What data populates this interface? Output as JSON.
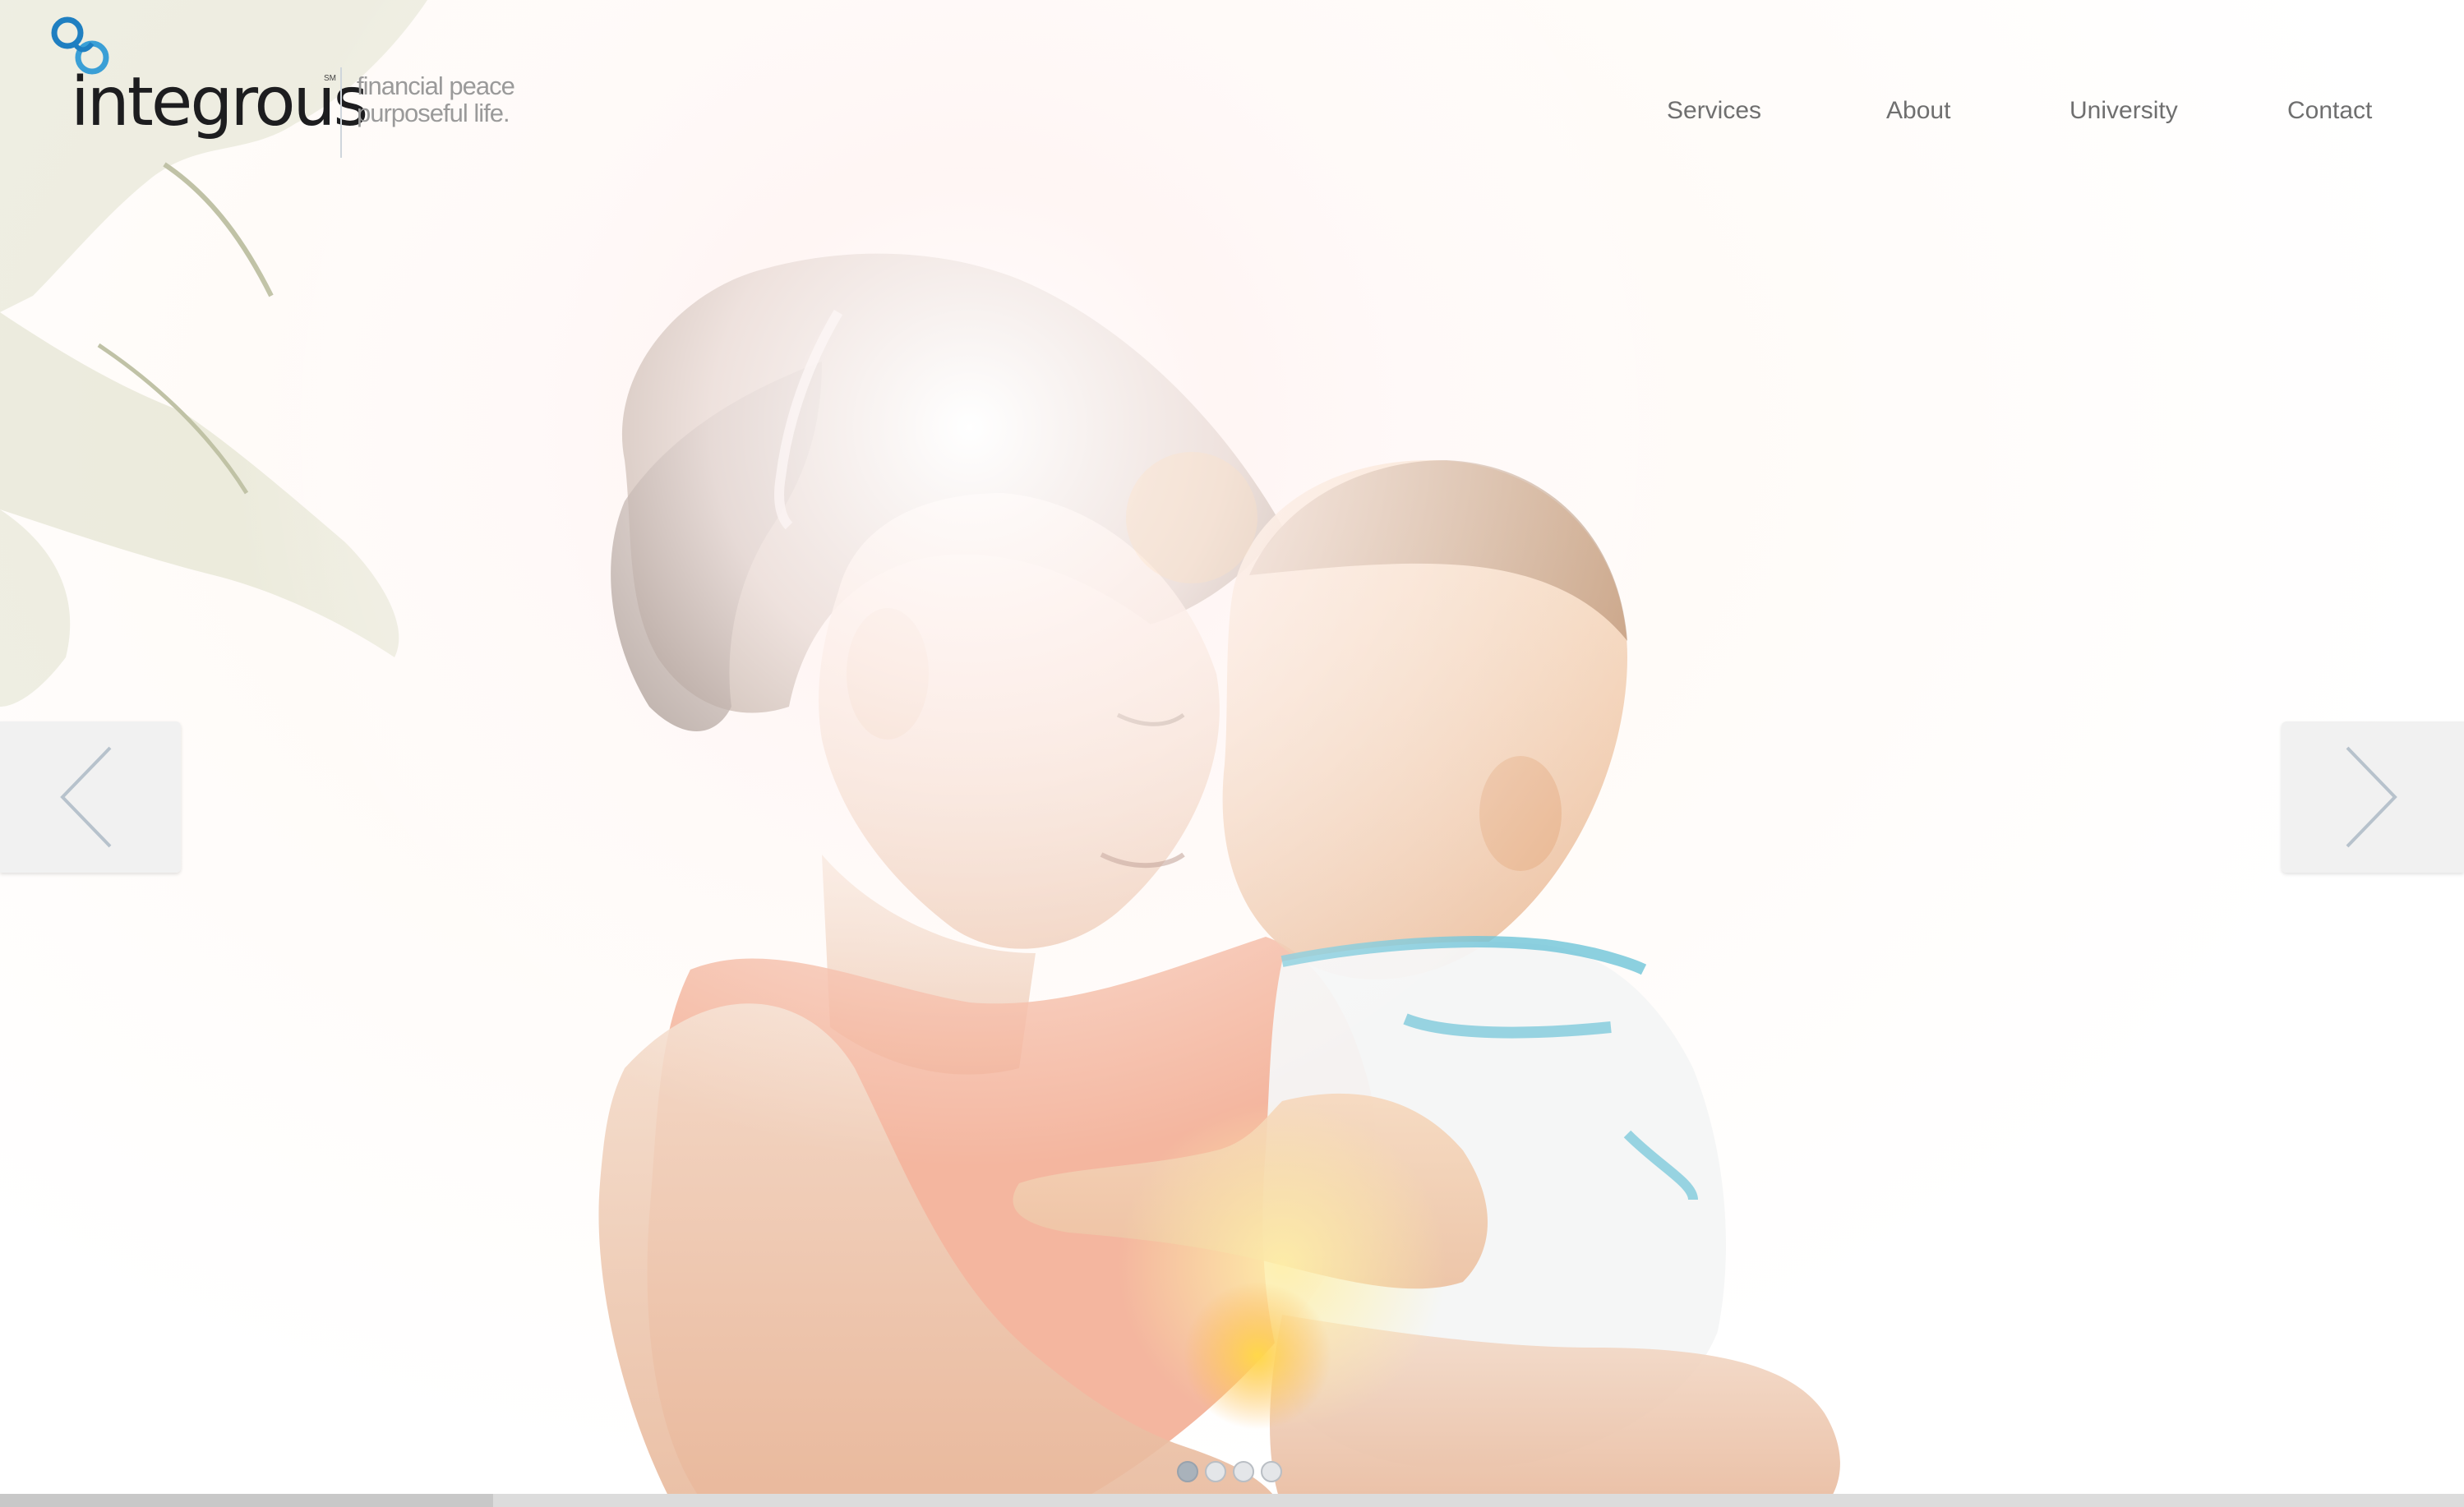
{
  "brand": {
    "name": "integrous",
    "service_mark": "SM",
    "tagline_line1": "financial peace",
    "tagline_line2": "purposeful life.",
    "logo_color": "#1f7fc1"
  },
  "nav": {
    "items": [
      {
        "label": "Services"
      },
      {
        "label": "About"
      },
      {
        "label": "University"
      },
      {
        "label": "Contact"
      }
    ]
  },
  "slider": {
    "slide_count": 4,
    "active_index": 0,
    "progress": 0.2,
    "prev_icon": "chevron-left-icon",
    "next_icon": "chevron-right-icon"
  },
  "colors": {
    "nav_text": "#6f6f6f",
    "tagline_text": "#9a9a9a",
    "arrow_bg": "#f0f0f0",
    "accent_blue": "#1f7fc1"
  }
}
